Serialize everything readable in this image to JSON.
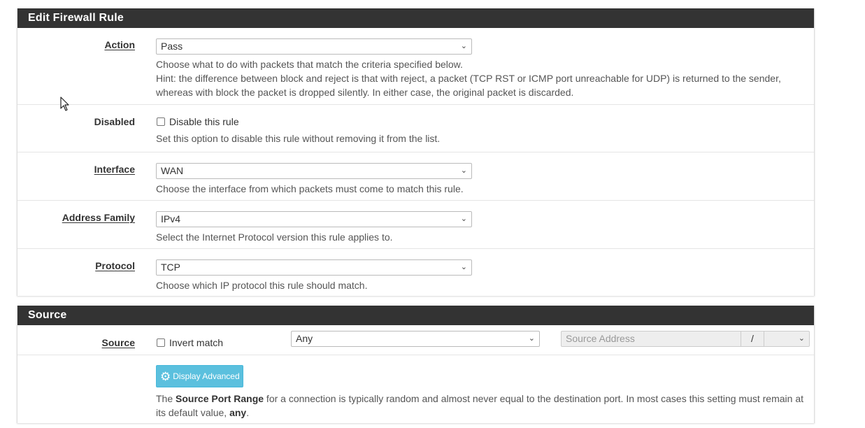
{
  "edit_panel": {
    "title": "Edit Firewall Rule",
    "action": {
      "label": "Action",
      "value": "Pass",
      "help1": "Choose what to do with packets that match the criteria specified below.",
      "help2": "Hint: the difference between block and reject is that with reject, a packet (TCP RST or ICMP port unreachable for UDP) is returned to the sender,",
      "help3": "whereas with block the packet is dropped silently. In either case, the original packet is discarded."
    },
    "disabled": {
      "label": "Disabled",
      "checkbox_label": "Disable this rule",
      "checked": false,
      "help": "Set this option to disable this rule without removing it from the list."
    },
    "interface": {
      "label": "Interface",
      "value": "WAN",
      "help": "Choose the interface from which packets must come to match this rule."
    },
    "address_family": {
      "label": "Address Family",
      "value": "IPv4",
      "help": "Select the Internet Protocol version this rule applies to."
    },
    "protocol": {
      "label": "Protocol",
      "value": "TCP",
      "help": "Choose which IP protocol this rule should match."
    }
  },
  "source_panel": {
    "title": "Source",
    "source": {
      "label": "Source",
      "invert_label": "Invert match",
      "invert_checked": false,
      "type_value": "Any",
      "address_placeholder": "Source Address",
      "slash": "/"
    },
    "advanced": {
      "button_label": "Display Advanced",
      "help_prefix": "The ",
      "help_bold1": "Source Port Range",
      "help_mid": " for a connection is typically random and almost never equal to the destination port. In most cases this setting must remain at",
      "help_line2_prefix": "its default value, ",
      "help_bold2": "any",
      "help_suffix": "."
    }
  },
  "icons": {
    "chevron": "chevron-down-icon",
    "gear": "gear-icon",
    "cursor": "mouse-pointer-icon"
  },
  "colors": {
    "panel_header_bg": "#333333",
    "button_info": "#5bc0de"
  }
}
